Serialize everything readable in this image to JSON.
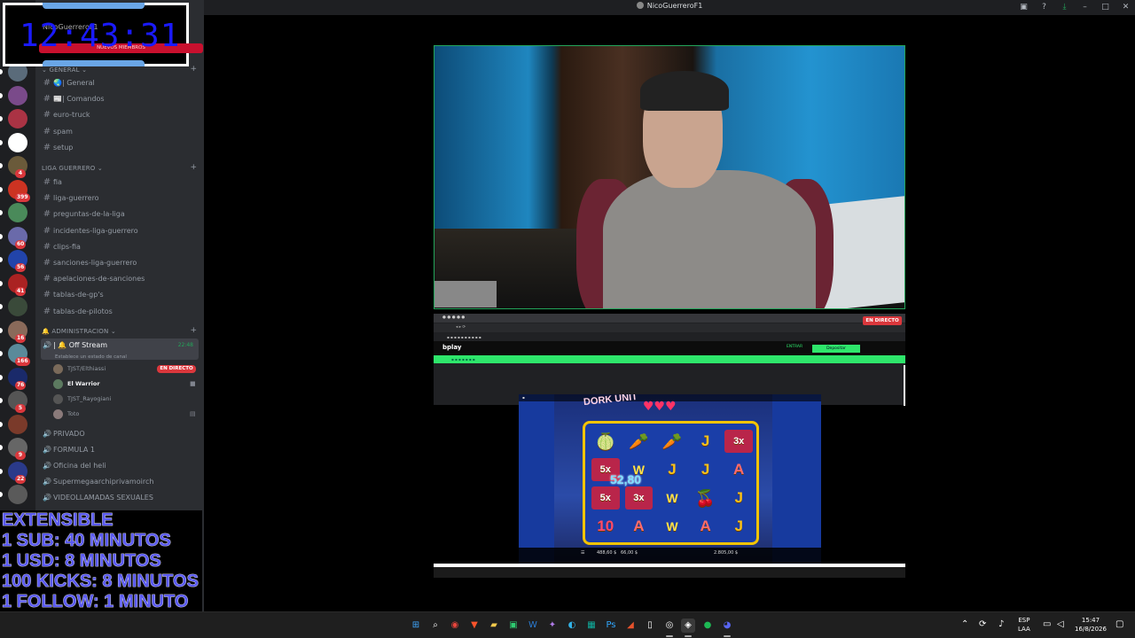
{
  "window": {
    "title": "NicoGuerreroF1"
  },
  "clock_overlay": {
    "time": "12:43:31",
    "ghost_text": "NicoGuerreroF1",
    "red_bar_text": "NUEVOS MIEMBROS"
  },
  "server_badges": [
    "4",
    "399",
    "60",
    "56",
    "41",
    "16",
    "166",
    "76",
    "5",
    "9",
    "22"
  ],
  "categories": {
    "general": "GENERAL",
    "liga": "LIGA GUERRERO",
    "admin": "ADMINISTRACION"
  },
  "channels_general": [
    "🌏| General",
    "📰| Comandos",
    "euro-truck",
    "spam",
    "setup"
  ],
  "channels_liga": [
    "fia",
    "liga-guerrero",
    "preguntas-de-la-liga",
    "incidentes-liga-guerrero",
    "clips-fia",
    "sanciones-liga-guerrero",
    "apelaciones-de-sanciones",
    "tablas-de-gp's",
    "tablas-de-pilotos"
  ],
  "voice_active": {
    "name": "| 🔔 Off Stream",
    "time": "22:48",
    "status": "Establece un estado de canal"
  },
  "voice_members": [
    {
      "name": "TJST/Elthiassi",
      "color": "#7a6a5a"
    },
    {
      "name": "El Warrior",
      "color": "#5c7a60"
    },
    {
      "name": "TJST_Rayogiani",
      "color": "#555"
    },
    {
      "name": "Toto",
      "color": "#8a7a7a"
    }
  ],
  "live_label": "EN DIRECTO",
  "voice_channels": [
    "PRIVADO",
    "FORMULA 1",
    "Oficina del heli",
    "Supermegaarchiprivamoirch",
    "VIDEOLLAMADAS SEXUALES"
  ],
  "extensible": [
    "EXTENSIBLE",
    "1 SUB: 40 MINUTOS",
    "1 USD: 8 MINUTOS",
    "100 KICKS: 8 MINUTOS",
    "1 FOLLOW: 1 MINUTO"
  ],
  "browser": {
    "site_logo": "bplay",
    "deposit": "Depositar",
    "enter": "ENTRAR",
    "live_tag": "EN DIRECTO"
  },
  "game": {
    "logo": "DORK UNIT",
    "win_amount": "52,80",
    "grid": [
      [
        "🍈",
        "🥕",
        "🥕",
        "J",
        "3x"
      ],
      [
        "5x",
        "W",
        "J",
        "J",
        "A"
      ],
      [
        "5x",
        "3x",
        "W",
        "🍒",
        "J"
      ],
      [
        "10",
        "A",
        "W",
        "A",
        "J"
      ]
    ],
    "balance": "488,60 $",
    "bet": "66,00 $",
    "total_win": "2.805,00 $"
  },
  "taskbar": {
    "lang_top": "ESP",
    "lang_bottom": "LAA",
    "time": "15:47",
    "date": "16/8/2026"
  }
}
